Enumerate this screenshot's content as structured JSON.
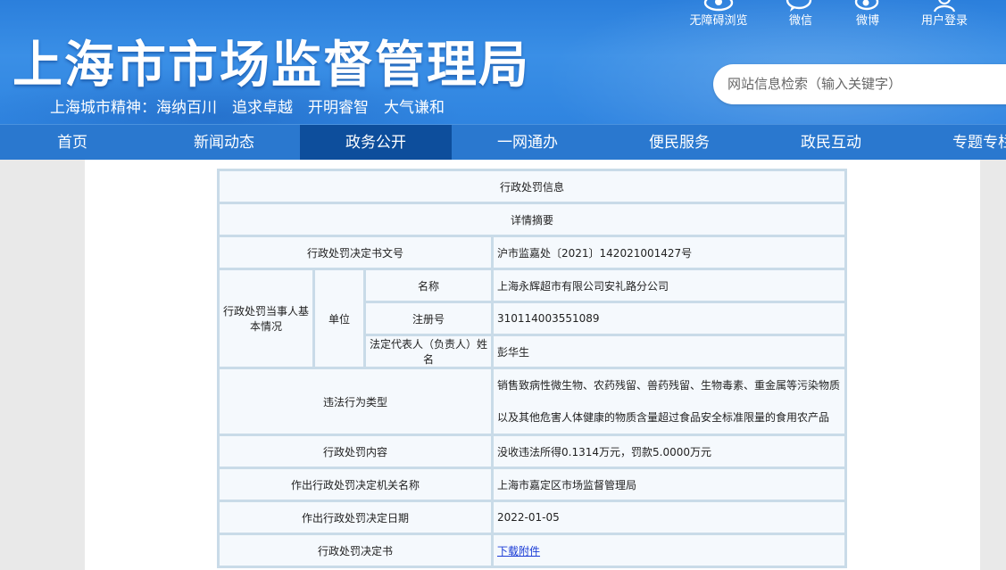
{
  "header": {
    "site_title": "上海市市场监督管理局",
    "slogan": "上海城市精神：海纳百川　追求卓越　开明睿智　大气谦和",
    "top_links": [
      {
        "label": "无障碍浏览",
        "icon": "eye-icon"
      },
      {
        "label": "微信",
        "icon": "wechat-icon"
      },
      {
        "label": "微博",
        "icon": "weibo-icon"
      },
      {
        "label": "用户登录",
        "icon": "user-icon"
      }
    ],
    "search_placeholder": "网站信息检索（输入关键字）"
  },
  "nav": {
    "items": [
      "首页",
      "新闻动态",
      "政务公开",
      "一网通办",
      "便民服务",
      "政民互动",
      "专题专栏"
    ],
    "active_index": 2
  },
  "record": {
    "title": "行政处罚信息",
    "summary": "详情摘要",
    "decision_no_label": "行政处罚决定书文号",
    "decision_no": "沪市监嘉处〔2021〕142021001427号",
    "party_label": "行政处罚当事人基本情况",
    "unit_label": "单位",
    "name_label": "名称",
    "name": "上海永辉超市有限公司安礼路分公司",
    "reg_no_label": "注册号",
    "reg_no": "310114003551089",
    "legal_rep_label": "法定代表人（负责人）姓名",
    "legal_rep": "彭华生",
    "violation_type_label": "违法行为类型",
    "violation_type": "销售致病性微生物、农药残留、兽药残留、生物毒素、重金属等污染物质以及其他危害人体健康的物质含量超过食品安全标准限量的食用农产品",
    "penalty_content_label": "行政处罚内容",
    "penalty_content": "没收违法所得0.1314万元，罚款5.0000万元",
    "authority_label": "作出行政处罚决定机关名称",
    "authority": "上海市嘉定区市场监督管理局",
    "date_label": "作出行政处罚决定日期",
    "date": "2022-01-05",
    "document_label": "行政处罚决定书",
    "download_link": "下载附件"
  }
}
